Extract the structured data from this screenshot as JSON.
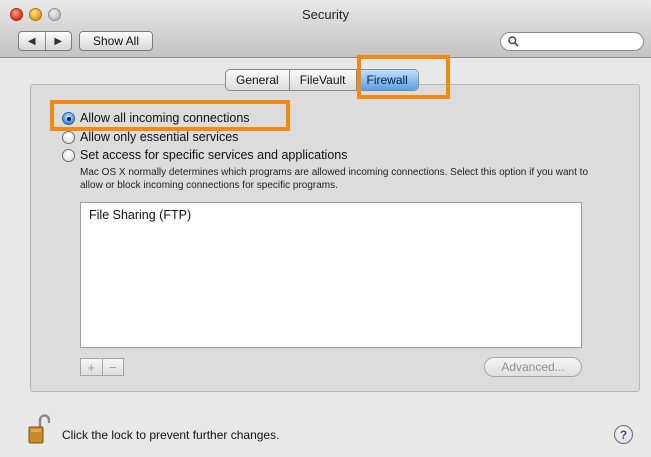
{
  "window": {
    "title": "Security"
  },
  "toolbar": {
    "back_glyph": "◀",
    "forward_glyph": "▶",
    "show_all_label": "Show All",
    "search": {
      "placeholder": "",
      "value": ""
    }
  },
  "tabs": [
    {
      "label": "General",
      "active": false
    },
    {
      "label": "FileVault",
      "active": false
    },
    {
      "label": "Firewall",
      "active": true
    }
  ],
  "firewall": {
    "options": [
      {
        "label": "Allow all incoming connections",
        "selected": true
      },
      {
        "label": "Allow only essential services",
        "selected": false
      },
      {
        "label": "Set access for specific services and applications",
        "selected": false
      }
    ],
    "description": "Mac OS X normally determines which programs are allowed incoming connections. Select this option if you want to allow or block incoming connections for specific programs.",
    "services": [
      "File Sharing (FTP)"
    ],
    "add_label": "+",
    "remove_label": "−",
    "advanced_label": "Advanced..."
  },
  "footer": {
    "lock_text": "Click the lock to prevent further changes.",
    "help_label": "?"
  },
  "colors": {
    "highlight": "#f08a13",
    "selected_tab": "#5a9fe8",
    "radio_selected": "#3e88de"
  }
}
